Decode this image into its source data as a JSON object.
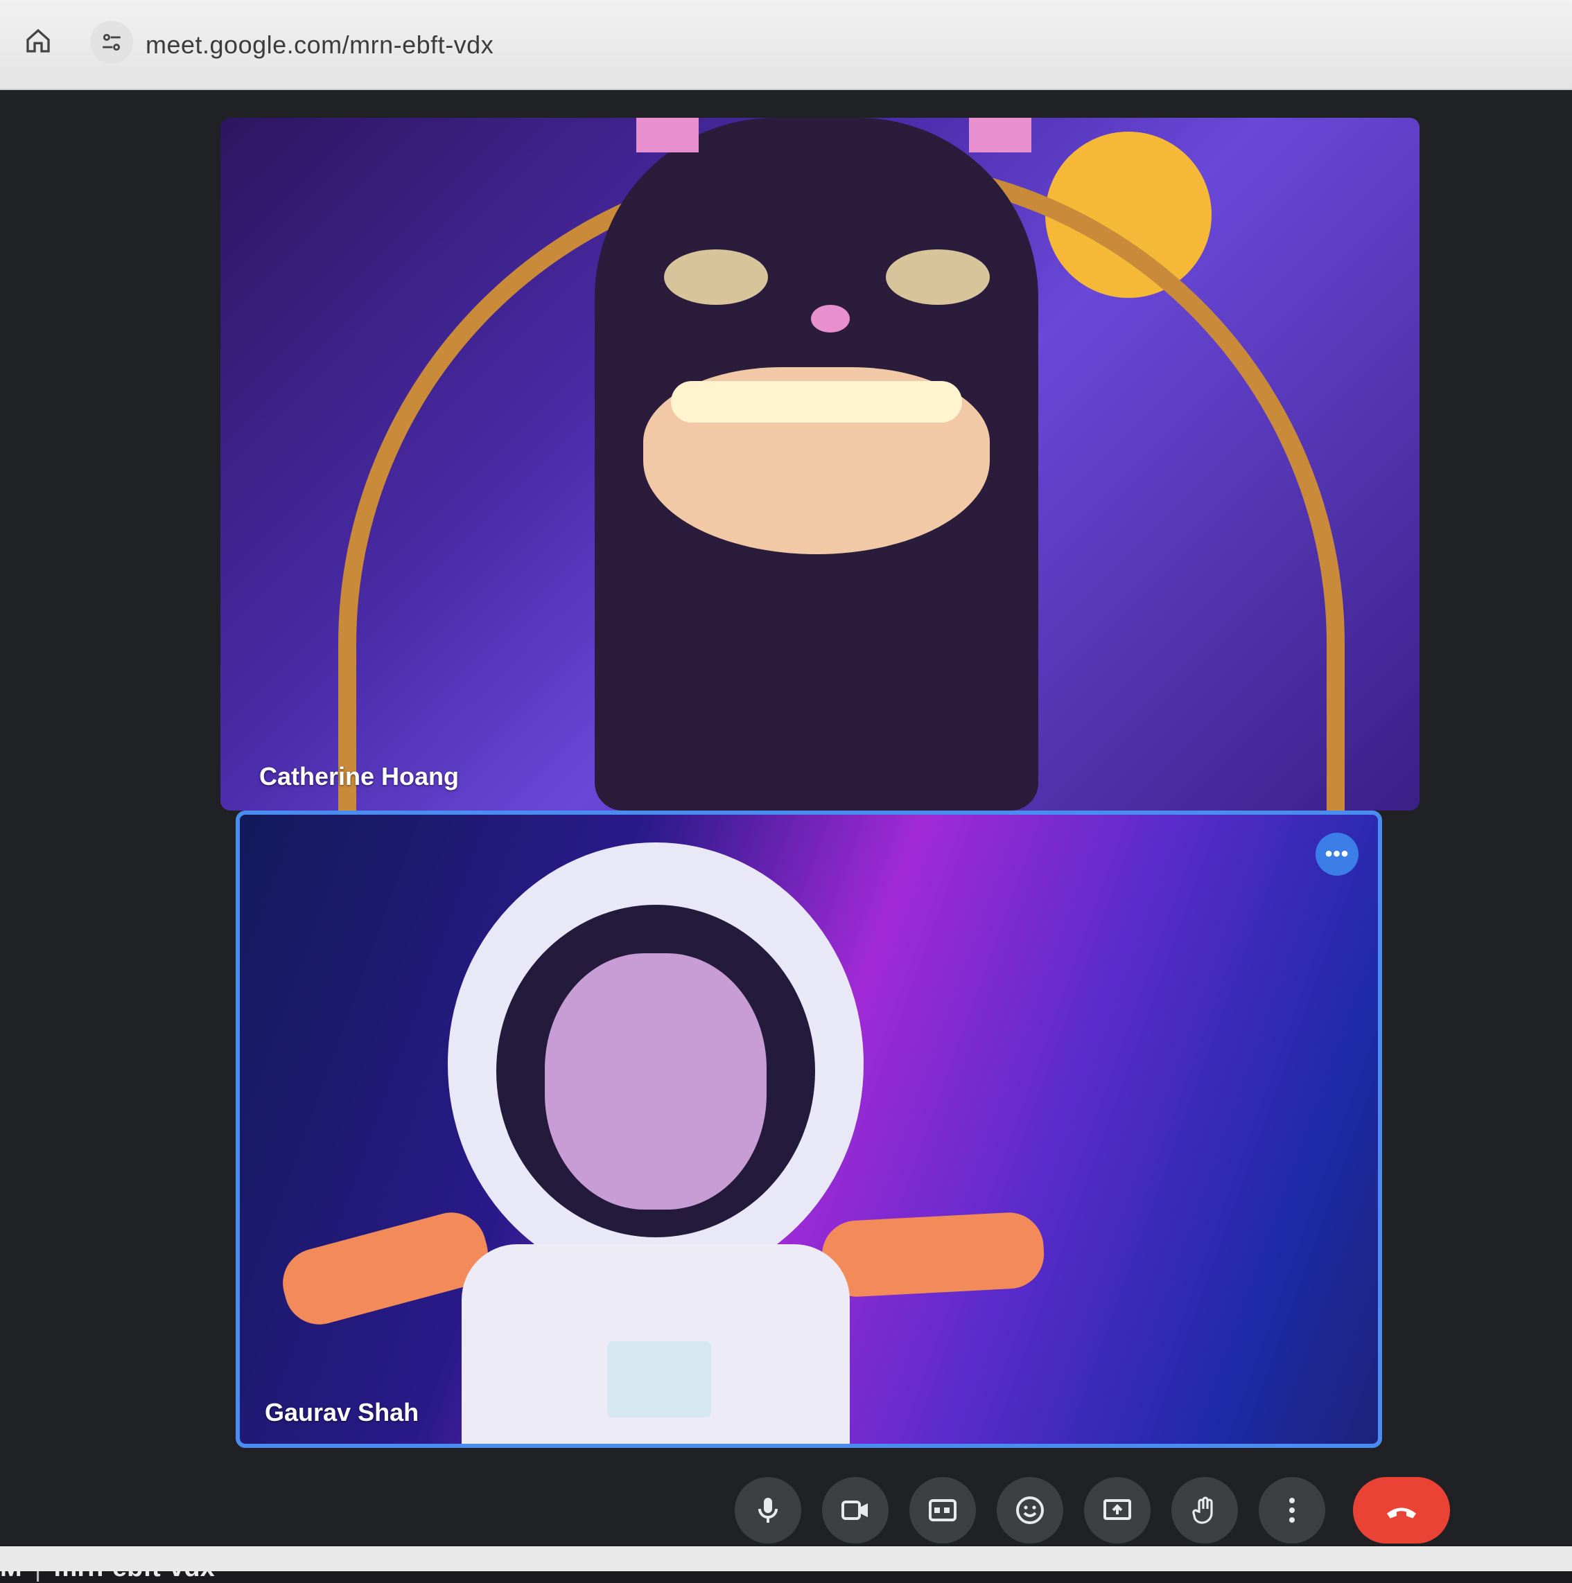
{
  "browser": {
    "url": "meet.google.com/mrn-ebft-vdx",
    "icons": {
      "home": "home-icon",
      "site_info": "tune-icon"
    }
  },
  "participants": [
    {
      "name": "Catherine Hoang",
      "effect": "cat-costume"
    },
    {
      "name": "Gaurav Shah",
      "effect": "astronaut",
      "active_speaker": true,
      "more_badge": "•••"
    }
  ],
  "meeting": {
    "time_fragment": "M",
    "separator": "|",
    "code": "mrn-ebft-vdx"
  },
  "controls": [
    {
      "name": "microphone",
      "icon": "mic-icon"
    },
    {
      "name": "camera",
      "icon": "video-camera-icon"
    },
    {
      "name": "captions",
      "icon": "captions-icon"
    },
    {
      "name": "reactions",
      "icon": "emoji-icon"
    },
    {
      "name": "present",
      "icon": "present-screen-icon"
    },
    {
      "name": "raise-hand",
      "icon": "hand-icon"
    },
    {
      "name": "more-options",
      "icon": "more-vert-icon"
    },
    {
      "name": "leave-call",
      "icon": "call-end-icon"
    }
  ],
  "colors": {
    "accent_blue": "#4a8cf0",
    "end_call_red": "#ea4335",
    "control_bg": "#3c4043",
    "stage_bg": "#202124"
  }
}
